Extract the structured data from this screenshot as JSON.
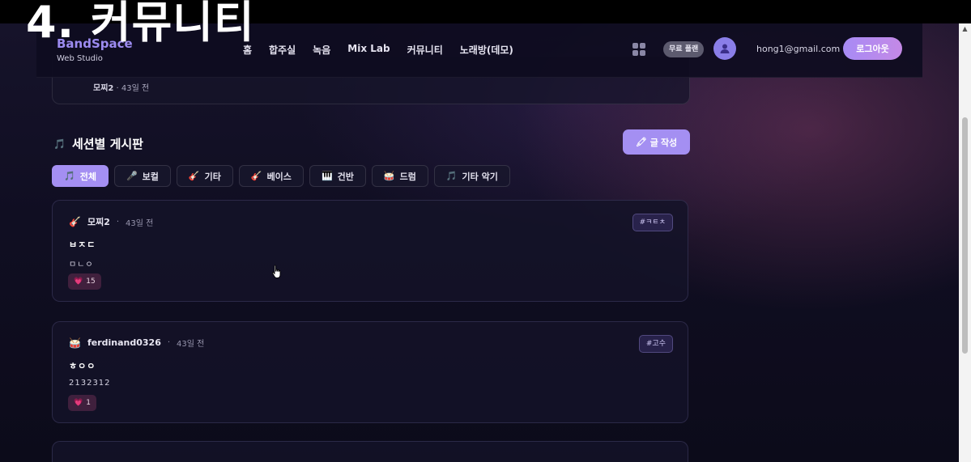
{
  "video_title": "4. 커뮤니티",
  "brand": {
    "name": "BandSpace",
    "subtitle": "Web Studio"
  },
  "nav": {
    "items": [
      "홈",
      "합주실",
      "녹음",
      "Mix Lab",
      "커뮤니티",
      "노래방(데모)"
    ]
  },
  "user": {
    "plan_badge": "무료 플랜",
    "email": "hong1@gmail.com",
    "logout_label": "로그아웃"
  },
  "previous_post": {
    "author": "모찌2",
    "time": "· 43일 전"
  },
  "board": {
    "title": "세션별 게시판",
    "write_label": "글 작성",
    "filters": [
      {
        "icon": "🎵",
        "label": "전체",
        "active": true
      },
      {
        "icon": "🎤",
        "label": "보컬"
      },
      {
        "icon": "🎸",
        "label": "기타"
      },
      {
        "icon": "🎸",
        "label": "베이스"
      },
      {
        "icon": "🎹",
        "label": "건반"
      },
      {
        "icon": "🥁",
        "label": "드럼"
      },
      {
        "icon": "🎵",
        "label": "기타 악기"
      }
    ]
  },
  "posts": [
    {
      "icon": "🎸",
      "author": "모찌2",
      "time": "43일 전",
      "tag": "#ㅋㅌㅊ",
      "title": "ㅂㅈㄷ",
      "body": "ㅁㄴㅇ",
      "likes": "15"
    },
    {
      "icon": "🥁",
      "author": "ferdinand0326",
      "time": "43일 전",
      "tag": "#고수",
      "title": "ㅎㅇㅇ",
      "body": "2132312",
      "likes": "1"
    }
  ],
  "colors": {
    "accent": "#a48ff2",
    "background": "#0b0a18",
    "brand": "#9c8bf0"
  }
}
